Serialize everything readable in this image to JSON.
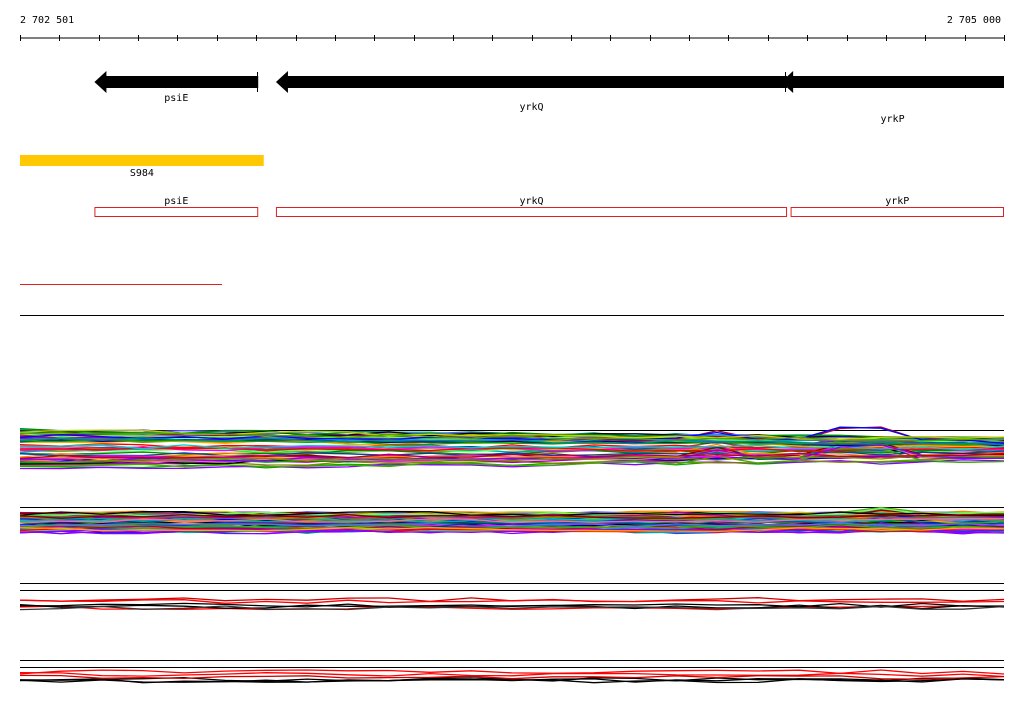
{
  "ruler": {
    "start_label": "2 702 501",
    "end_label": "2 705 000",
    "start": 2702501,
    "end": 2705000
  },
  "genes": [
    {
      "name": "psiE",
      "strand": "-",
      "start": 2702690,
      "end": 2703106
    },
    {
      "name": "yrkQ",
      "strand": "-",
      "start": 2703151,
      "end": 2704449
    },
    {
      "name": "yrkP",
      "strand": "-",
      "start": 2704434,
      "end": 2705000
    }
  ],
  "segments": [
    {
      "name": "S984",
      "start": 2702501,
      "end": 2703120,
      "color": "#ffc800"
    }
  ],
  "cds_boxes": [
    {
      "name": "psiE",
      "start": 2702690,
      "end": 2703106
    },
    {
      "name": "yrkQ",
      "start": 2703151,
      "end": 2704449
    },
    {
      "name": "yrkP",
      "start": 2704458,
      "end": 2705000
    }
  ],
  "colors": {
    "gene_arrow": "#000000",
    "segment": "#ffc800",
    "cds_outline": "#dd2222",
    "red_line": "#dd2222"
  }
}
